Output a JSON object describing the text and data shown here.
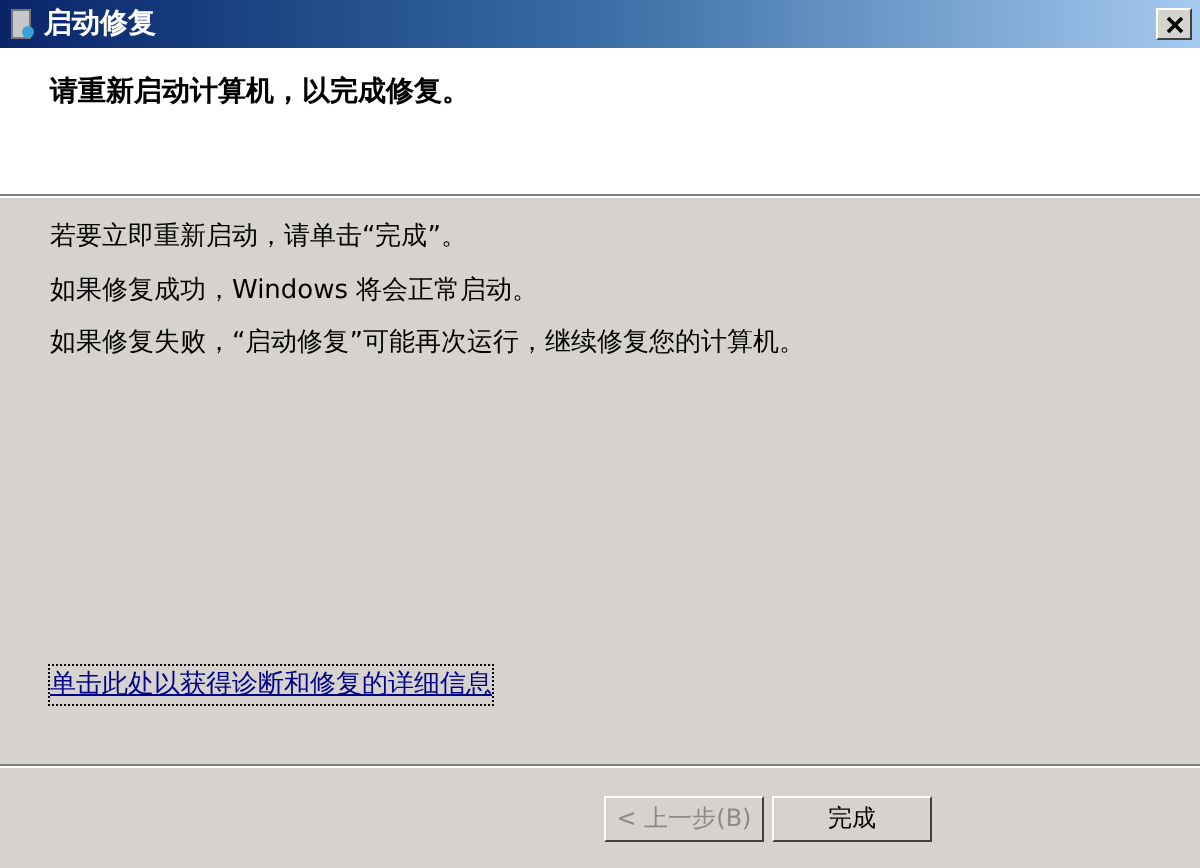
{
  "window": {
    "title": "启动修复"
  },
  "heading": "请重新启动计算机，以完成修复。",
  "messages": [
    "若要立即重新启动，请单击“完成”。",
    "如果修复成功，Windows 将会正常启动。",
    "如果修复失败，“启动修复”可能再次运行，继续修复您的计算机。"
  ],
  "details_link": "单击此处以获得诊断和修复的详细信息",
  "buttons": [
    {
      "label": "< 上一步(B)",
      "disabled": true
    },
    {
      "label": "完成",
      "disabled": false
    }
  ]
}
